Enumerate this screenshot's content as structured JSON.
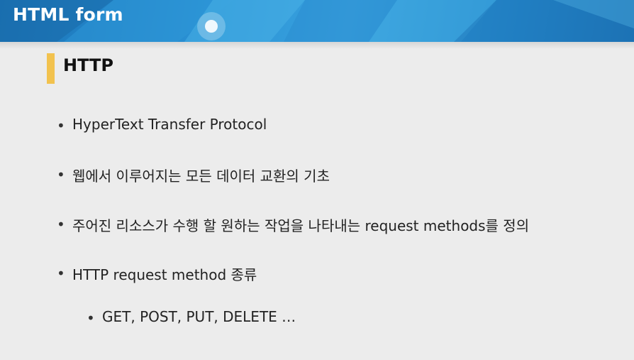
{
  "header": {
    "title": "HTML form"
  },
  "section": {
    "title": "HTTP"
  },
  "bullets": [
    "HyperText Transfer Protocol",
    "웹에서 이루어지는 모든 데이터 교환의 기초",
    "주어진 리소스가 수행 할 원하는 작업을 나타내는 request methods를 정의",
    "HTTP request method 종류"
  ],
  "sub_bullets": [
    "GET, POST, PUT, DELETE …"
  ],
  "bullet_glyph": "•",
  "colors": {
    "header_blue": "#2b93d6",
    "accent_yellow": "#f2c24e",
    "background": "#ececec",
    "text": "#222222"
  }
}
